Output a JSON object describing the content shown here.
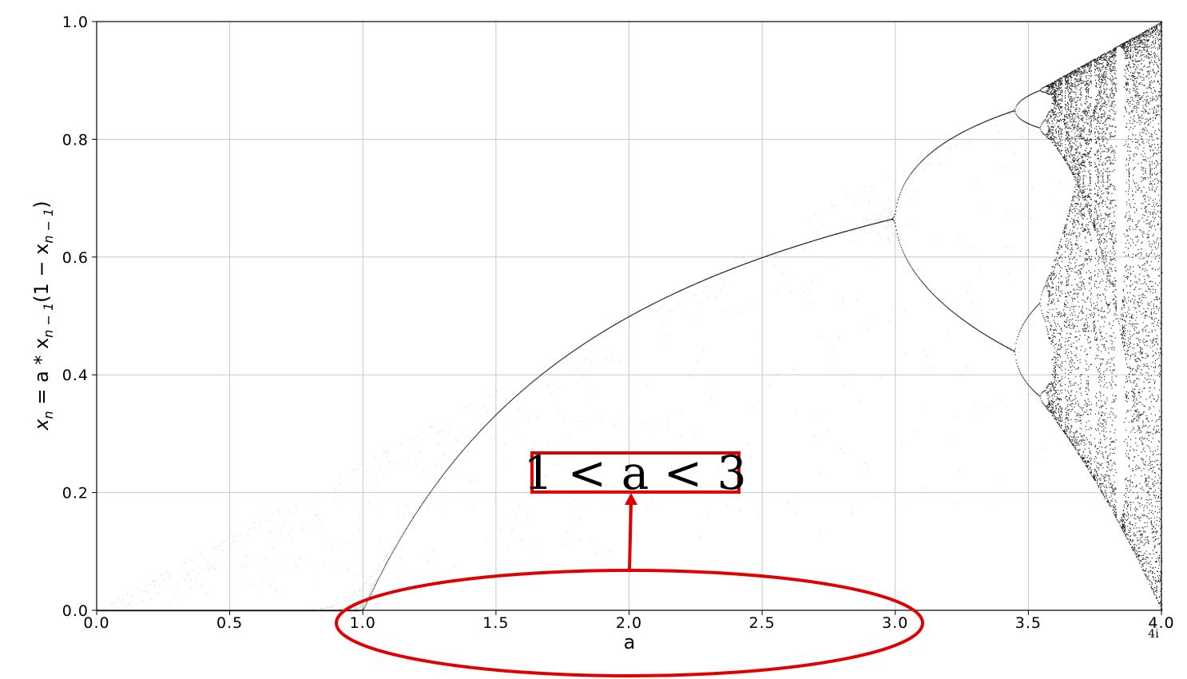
{
  "chart_data": {
    "type": "scatter",
    "title": "",
    "xlabel": "a",
    "ylabel": "x_n = a * x_{n-1}(1 − x_{n-1})",
    "xlim": [
      0.0,
      4.0
    ],
    "ylim": [
      0.0,
      1.0
    ],
    "xticks": [
      "0.0",
      "0.5",
      "1.0",
      "1.5",
      "2.0",
      "2.5",
      "3.0",
      "3.5",
      "4.0"
    ],
    "yticks": [
      "0.0",
      "0.2",
      "0.4",
      "0.6",
      "0.8",
      "1.0"
    ],
    "grid": true,
    "point_color": "#000000",
    "fixed_point_curve": {
      "a": [
        0.0,
        0.5,
        1.0,
        1.5,
        2.0,
        2.5,
        2.9,
        3.0
      ],
      "x": [
        0.0,
        0.0,
        0.0,
        0.333,
        0.5,
        0.6,
        0.655,
        0.667
      ]
    },
    "period_2_branches": {
      "a": [
        3.0,
        3.2,
        3.449
      ],
      "upper": [
        0.667,
        0.799,
        0.849
      ],
      "lower": [
        0.667,
        0.513,
        0.44
      ]
    },
    "chaos_region": {
      "a_start": 3.57,
      "a_end": 4.0,
      "x_min": 0.0,
      "x_max": 1.0
    },
    "annotation": {
      "text": "1 < a < 3",
      "highlight_range_a": [
        1.0,
        3.0
      ]
    },
    "annotation_color": "#e00000"
  },
  "ylabel_parts": {
    "x": "x",
    "n": "n",
    "eq": " = a * x",
    "n1": "n − 1",
    "mid": "(1 − x",
    "n1b": "n − 1",
    "close": ")"
  },
  "page_number": "4i"
}
